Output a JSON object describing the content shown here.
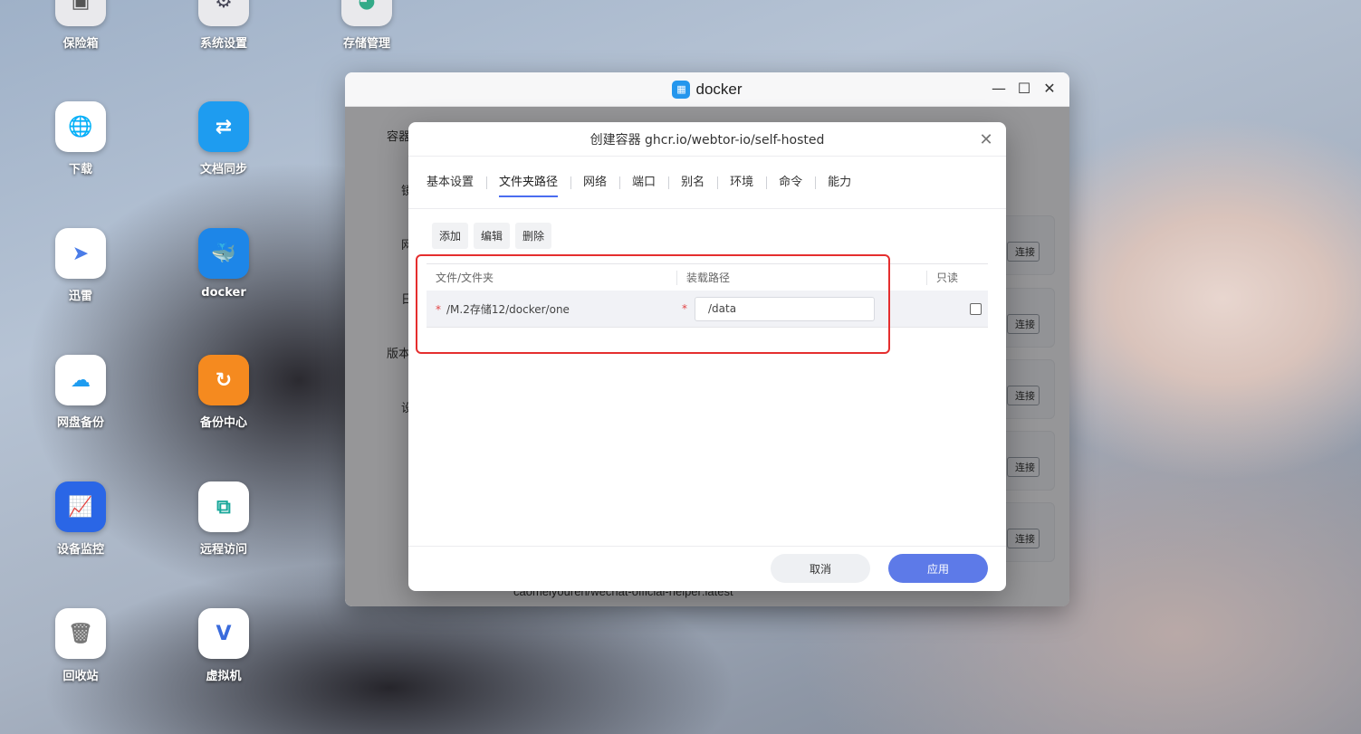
{
  "desktop": {
    "icons": [
      {
        "label": "保险箱",
        "icon": "safe-icon",
        "color": "#e9e9ec"
      },
      {
        "label": "系统设置",
        "icon": "settings-icon",
        "color": "#e9e9ec"
      },
      {
        "label": "存储管理",
        "icon": "storage-icon",
        "color": "#e9e9ec"
      },
      {
        "label": "下载",
        "icon": "download-globe-icon",
        "color": "#ffffff"
      },
      {
        "label": "文档同步",
        "icon": "doc-sync-icon",
        "color": "#1e9cf0"
      },
      {
        "label": "迅雷",
        "icon": "thunder-icon",
        "color": "#ffffff"
      },
      {
        "label": "docker",
        "icon": "docker-icon",
        "color": "#1d86e8"
      },
      {
        "label": "网盘备份",
        "icon": "cloud-backup-icon",
        "color": "#ffffff"
      },
      {
        "label": "备份中心",
        "icon": "backup-center-icon",
        "color": "#f58a1f"
      },
      {
        "label": "设备监控",
        "icon": "monitor-icon",
        "color": "#2a66e6"
      },
      {
        "label": "远程访问",
        "icon": "remote-access-icon",
        "color": "#ffffff"
      },
      {
        "label": "回收站",
        "icon": "trash-icon",
        "color": "#ffffff"
      },
      {
        "label": "虚拟机",
        "icon": "vm-icon",
        "color": "#ffffff"
      }
    ]
  },
  "docker_window": {
    "title": "docker",
    "sidebar": {
      "item1": "容器",
      "item2": "镜",
      "item3": "网",
      "item4": "日",
      "item5": "版本",
      "item6": "设"
    },
    "card_button": "连接",
    "bottom_text": "caomeiyouren/wechat-official-helper:latest"
  },
  "modal": {
    "title": "创建容器 ghcr.io/webtor-io/self-hosted",
    "tabs": [
      "基本设置",
      "文件夹路径",
      "网络",
      "端口",
      "别名",
      "环境",
      "命令",
      "能力"
    ],
    "active_tab": "文件夹路径",
    "toolbar": {
      "add": "添加",
      "edit": "编辑",
      "delete": "删除"
    },
    "table": {
      "headers": {
        "file": "文件/文件夹",
        "mount": "装载路径",
        "readonly": "只读"
      },
      "rows": [
        {
          "file": "/M.2存储12/docker/one",
          "mount": "/data",
          "readonly": false
        }
      ]
    },
    "footer": {
      "cancel": "取消",
      "apply": "应用"
    }
  },
  "colors": {
    "accent": "#5d7ae8",
    "highlight": "#e52e2e"
  }
}
